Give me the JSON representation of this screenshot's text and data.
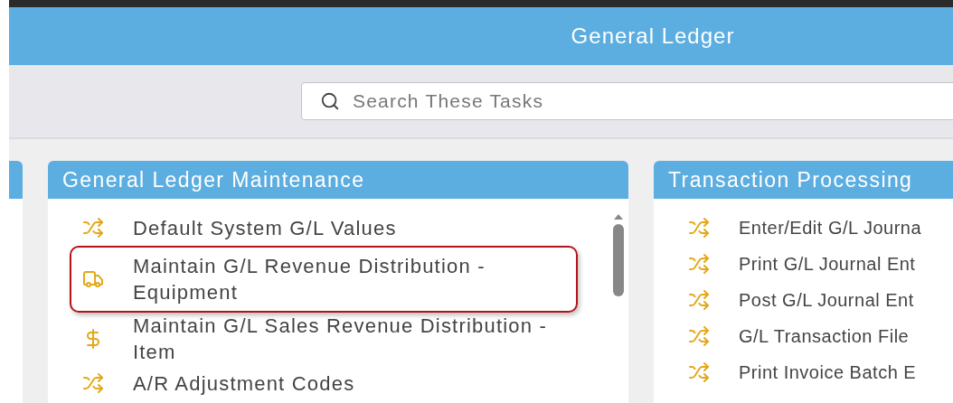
{
  "header": {
    "title": "General Ledger"
  },
  "search": {
    "placeholder": "Search These Tasks"
  },
  "panels": [
    {
      "title": "General Ledger Maintenance",
      "items": [
        {
          "kind": "shuffle",
          "label": "Default System G/L Values",
          "selected": false
        },
        {
          "kind": "truck",
          "label": "Maintain G/L Revenue Distribution - Equipment",
          "selected": true
        },
        {
          "kind": "dollar",
          "label": "Maintain G/L Sales Revenue Distribution - Item",
          "selected": false
        },
        {
          "kind": "shuffle",
          "label": "A/R Adjustment Codes",
          "selected": false
        }
      ]
    },
    {
      "title": "Transaction Processing",
      "items": [
        {
          "kind": "shuffle",
          "label": "Enter/Edit G/L Journa",
          "selected": false
        },
        {
          "kind": "shuffle",
          "label": "Print G/L Journal Ent",
          "selected": false
        },
        {
          "kind": "shuffle",
          "label": "Post G/L Journal Ent",
          "selected": false
        },
        {
          "kind": "shuffle",
          "label": "G/L Transaction File",
          "selected": false
        },
        {
          "kind": "shuffle",
          "label": "Print Invoice Batch E",
          "selected": false
        }
      ]
    }
  ]
}
